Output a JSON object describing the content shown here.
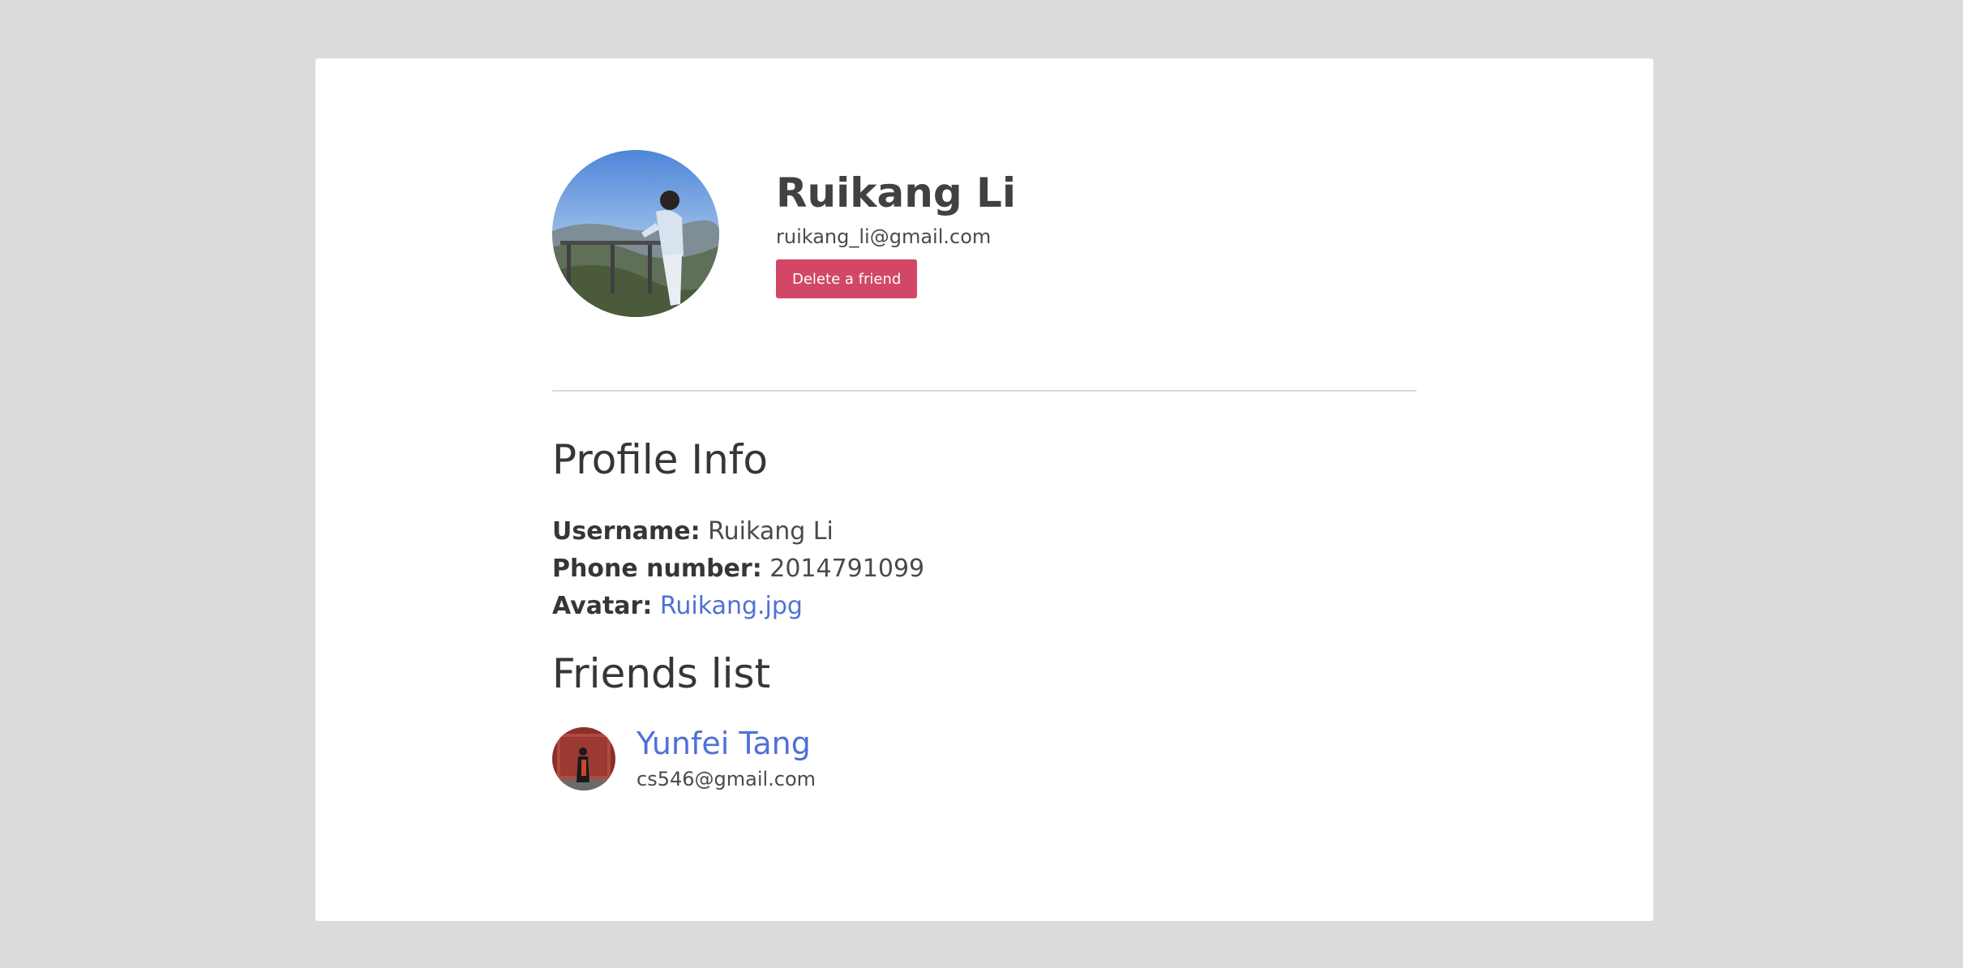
{
  "profile": {
    "name": "Ruikang Li",
    "email": "ruikang_li@gmail.com",
    "delete_button_label": "Delete a friend"
  },
  "profile_info": {
    "title": "Profile Info",
    "username_label": "Username:",
    "username_value": "Ruikang Li",
    "phone_label": "Phone number:",
    "phone_value": "2014791099",
    "avatar_label": "Avatar:",
    "avatar_value": "Ruikang.jpg"
  },
  "friends": {
    "title": "Friends list",
    "items": [
      {
        "name": "Yunfei Tang",
        "email": "cs546@gmail.com"
      }
    ]
  },
  "colors": {
    "accent_link": "#4f70d6",
    "danger_button": "#d24666",
    "page_background": "#dbdbdb"
  }
}
